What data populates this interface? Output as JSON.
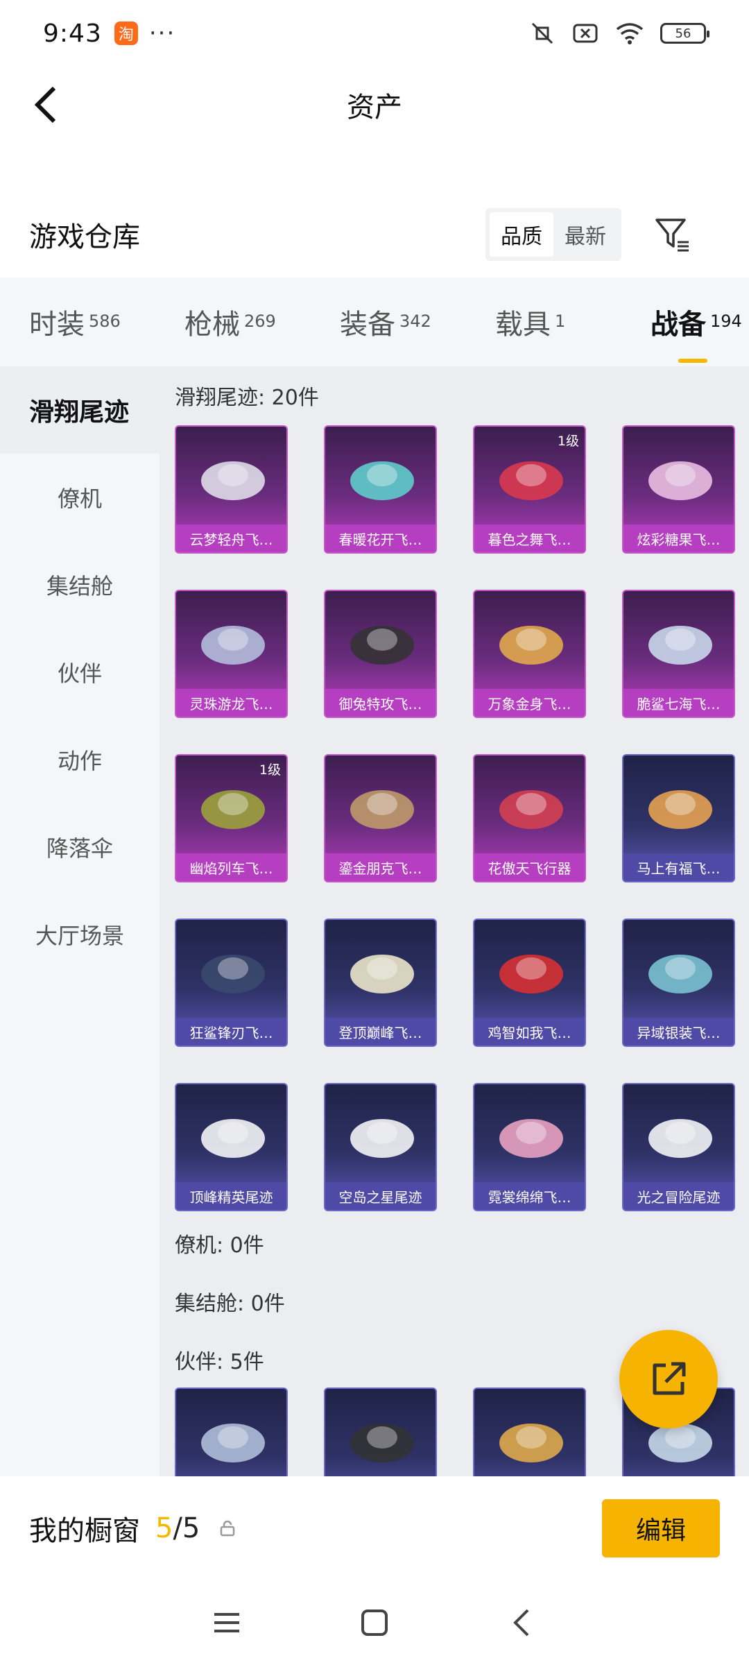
{
  "status_bar": {
    "time": "9:43",
    "badge": "淘",
    "more": "···",
    "battery": "56"
  },
  "header": {
    "title": "资产"
  },
  "warehouse": {
    "title": "游戏仓库",
    "sort": [
      "品质",
      "最新"
    ]
  },
  "tabs": [
    {
      "label": "时装",
      "count": "586"
    },
    {
      "label": "枪械",
      "count": "269"
    },
    {
      "label": "装备",
      "count": "342"
    },
    {
      "label": "载具",
      "count": "1"
    },
    {
      "label": "战备",
      "count": "194"
    }
  ],
  "sidebar": [
    "滑翔尾迹",
    "僚机",
    "集结舱",
    "伙伴",
    "动作",
    "降落伞",
    "大厅场景"
  ],
  "sections": {
    "glide": {
      "title": "滑翔尾迹: 20件"
    },
    "wingman": {
      "title": "僚机: 0件"
    },
    "pod": {
      "title": "集结舱: 0件"
    },
    "partner": {
      "title": "伙伴: 5件"
    }
  },
  "glide_items": [
    {
      "name": "云梦轻舟飞…",
      "rarity": "purple",
      "level": ""
    },
    {
      "name": "春暖花开飞…",
      "rarity": "purple",
      "level": ""
    },
    {
      "name": "暮色之舞飞…",
      "rarity": "purple",
      "level": "1级"
    },
    {
      "name": "炫彩糖果飞…",
      "rarity": "purple",
      "level": ""
    },
    {
      "name": "灵珠游龙飞…",
      "rarity": "purple",
      "level": ""
    },
    {
      "name": "御兔特攻飞…",
      "rarity": "purple",
      "level": ""
    },
    {
      "name": "万象金身飞…",
      "rarity": "purple",
      "level": ""
    },
    {
      "name": "脆鲨七海飞…",
      "rarity": "purple",
      "level": ""
    },
    {
      "name": "幽焰列车飞…",
      "rarity": "purple",
      "level": "1级"
    },
    {
      "name": "鎏金朋克飞…",
      "rarity": "purple",
      "level": ""
    },
    {
      "name": "花傲天飞行器",
      "rarity": "purple",
      "level": ""
    },
    {
      "name": "马上有福飞…",
      "rarity": "blue",
      "level": ""
    },
    {
      "name": "狂鲨锋刃飞…",
      "rarity": "blue",
      "level": ""
    },
    {
      "name": "登顶巅峰飞…",
      "rarity": "blue",
      "level": ""
    },
    {
      "name": "鸡智如我飞…",
      "rarity": "blue",
      "level": ""
    },
    {
      "name": "异域银装飞…",
      "rarity": "blue",
      "level": ""
    },
    {
      "name": "顶峰精英尾迹",
      "rarity": "blue",
      "level": ""
    },
    {
      "name": "空岛之星尾迹",
      "rarity": "blue",
      "level": ""
    },
    {
      "name": "霓裳绵绵飞…",
      "rarity": "blue",
      "level": ""
    },
    {
      "name": "光之冒险尾迹",
      "rarity": "blue",
      "level": ""
    }
  ],
  "partner_items": [
    {
      "rarity": "blue"
    },
    {
      "rarity": "blue"
    },
    {
      "rarity": "blue"
    },
    {
      "rarity": "blue"
    }
  ],
  "window": {
    "label": "我的橱窗",
    "current": "5",
    "total": "/5",
    "edit": "编辑"
  },
  "colors": {
    "accent": "#f6b301",
    "purple": "#b63ec0",
    "blue": "#4f4aa5"
  }
}
